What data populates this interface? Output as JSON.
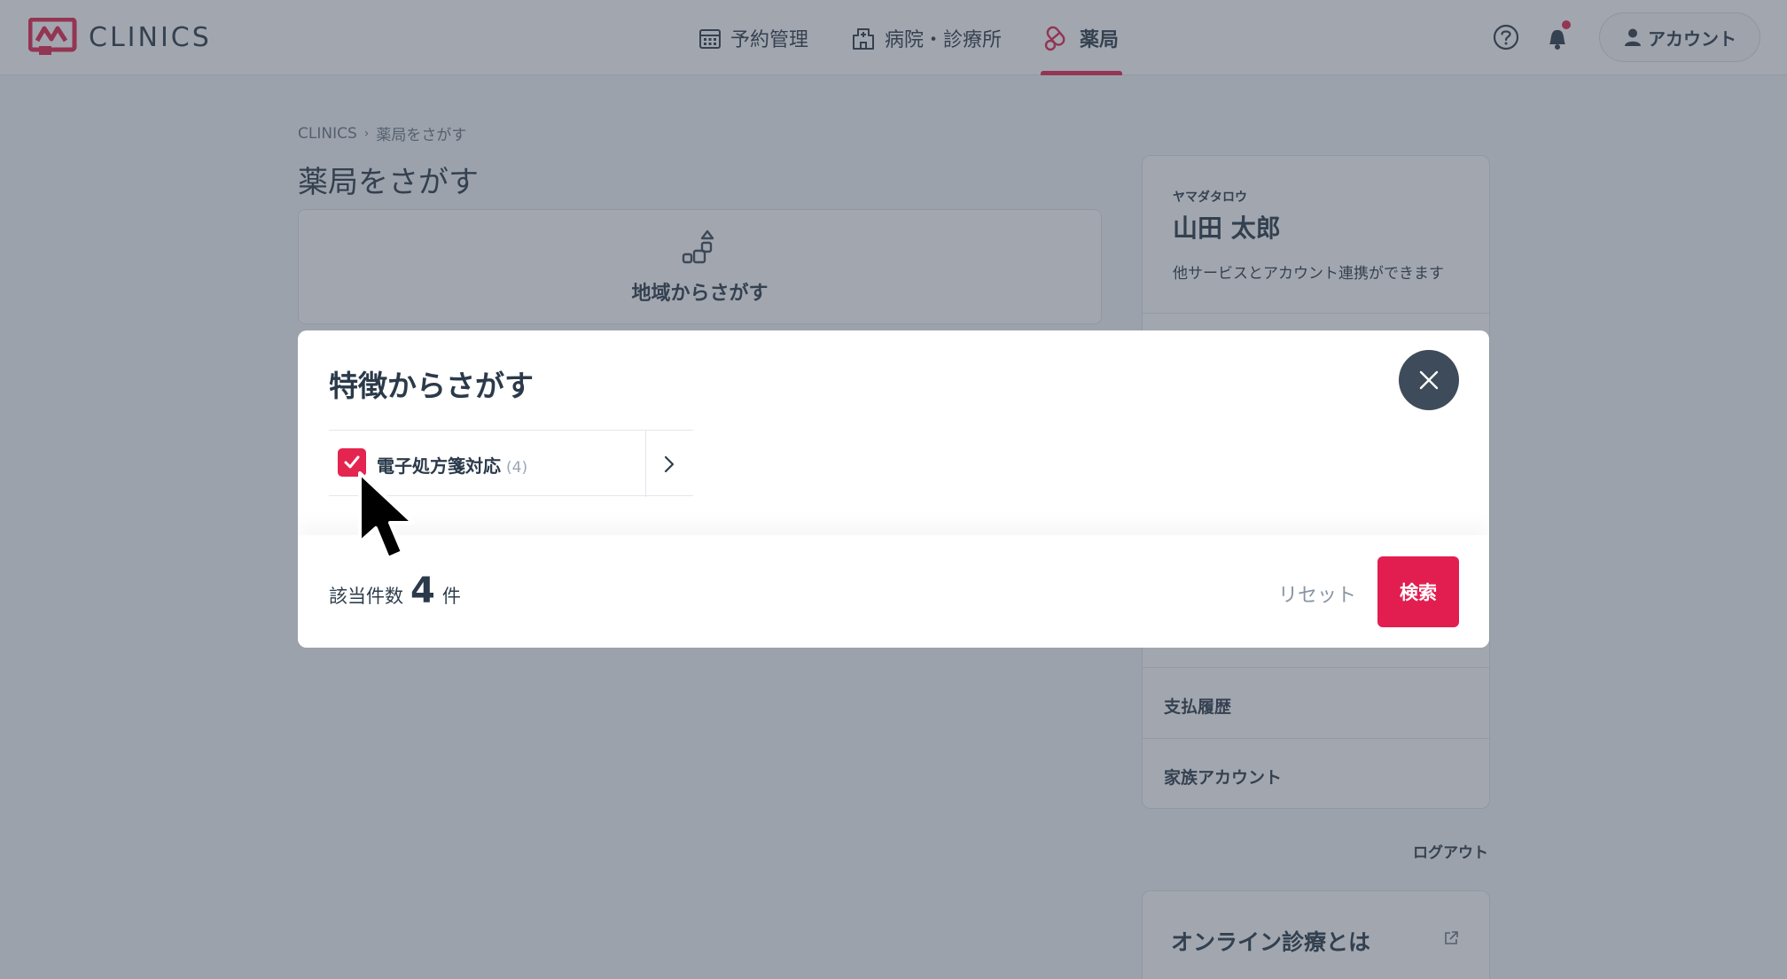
{
  "header": {
    "logo_text": "CLINICS",
    "nav": [
      {
        "label": "予約管理",
        "icon": "calendar-icon"
      },
      {
        "label": "病院・診療所",
        "icon": "hospital-icon"
      },
      {
        "label": "薬局",
        "icon": "pill-icon",
        "active": true
      }
    ],
    "account_label": "アカウント",
    "has_notification": true
  },
  "breadcrumb": {
    "root": "CLINICS",
    "current": "薬局をさがす"
  },
  "page_title": "薬局をさがす",
  "region_search": {
    "label": "地域からさがす"
  },
  "profile": {
    "kana": "ヤマダタロウ",
    "name": "山田 太郎",
    "note": "他サービスとアカウント連携ができます",
    "menu": [
      "支払履歴",
      "家族アカウント"
    ],
    "logout": "ログアウト"
  },
  "online_card": {
    "title": "オンライン診療とは"
  },
  "modal": {
    "title": "特徴からさがす",
    "filters": [
      {
        "label": "電子処方箋対応",
        "count": "(4)",
        "checked": true
      }
    ],
    "result_prefix": "該当件数",
    "result_count": "4",
    "result_suffix": "件",
    "reset_label": "リセット",
    "search_label": "検索"
  },
  "colors": {
    "accent": "#e3254f",
    "text": "#2b3a4a",
    "close_bg": "#3e4b5a"
  }
}
